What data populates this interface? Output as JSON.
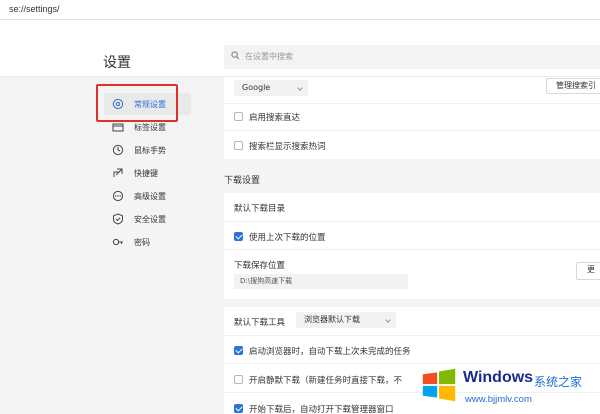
{
  "address_bar": {
    "url": "se://settings/"
  },
  "header": {
    "title": "设置",
    "search_placeholder": "在设置中搜索"
  },
  "sidebar": {
    "items": [
      {
        "label": "常规设置",
        "icon": "general-settings-icon",
        "active": true
      },
      {
        "label": "标签设置",
        "icon": "tab-settings-icon"
      },
      {
        "label": "鼠标手势",
        "icon": "mouse-gesture-icon"
      },
      {
        "label": "快捷键",
        "icon": "shortcut-icon"
      },
      {
        "label": "高级设置",
        "icon": "advanced-settings-icon"
      },
      {
        "label": "安全设置",
        "icon": "security-shield-icon"
      },
      {
        "label": "密码",
        "icon": "password-key-icon"
      }
    ]
  },
  "search_section": {
    "engine_value": "Google",
    "manage_button": "管理搜索引",
    "options": [
      {
        "label": "启用搜索直达",
        "checked": false
      },
      {
        "label": "搜索栏显示搜索热词",
        "checked": false
      }
    ]
  },
  "download_section": {
    "heading": "下载设置",
    "default_dir_label": "默认下载目录",
    "use_last_location": {
      "label": "使用上次下载的位置",
      "checked": true
    },
    "save_location_label": "下载保存位置",
    "save_path": "D:\\搜狗高速下载",
    "change_button": "更",
    "default_tool_label": "默认下载工具",
    "default_tool_value": "浏览器默认下载",
    "options": [
      {
        "label": "启动浏览器时，自动下载上次未完成的任务",
        "checked": true
      },
      {
        "label": "开启静默下载（新建任务时直接下载，不",
        "checked": false
      },
      {
        "label": "开始下载后，自动打开下载管理器窗口",
        "checked": true
      }
    ]
  },
  "watermark": {
    "brand": "Windows",
    "subtitle": "系统之家",
    "url": "www.bjjmlv.com",
    "logo_colors": [
      "#f25022",
      "#7fba00",
      "#00a4ef",
      "#ffb900"
    ]
  },
  "colors": {
    "accent": "#2d74d8",
    "highlight": "#e0302c"
  }
}
